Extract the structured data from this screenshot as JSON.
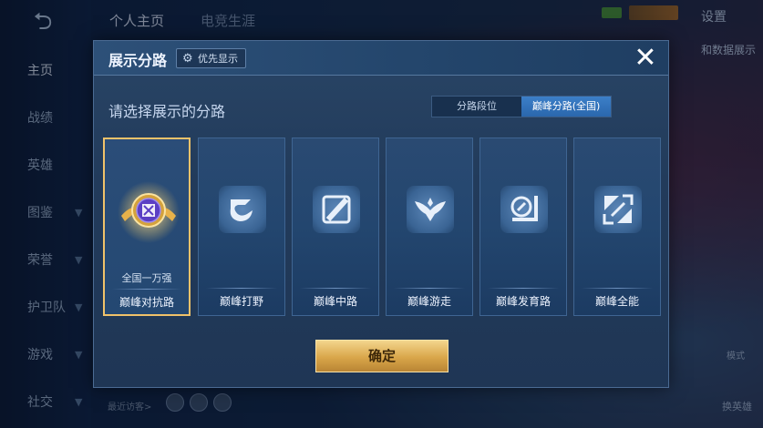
{
  "background": {
    "top_tabs": [
      "个人主页",
      "电竞生涯"
    ],
    "settings_label": "设置",
    "right_label": "和数据展示",
    "nav": [
      {
        "label": "主页"
      },
      {
        "label": "战绩"
      },
      {
        "label": "英雄"
      },
      {
        "label": "图鉴"
      },
      {
        "label": "荣誉"
      },
      {
        "label": "护卫队"
      },
      {
        "label": "游戏"
      },
      {
        "label": "社交"
      }
    ],
    "visitors_label": "最近访客>",
    "bottom_right_label": "换英雄",
    "bottom_right_label2": "模式"
  },
  "modal": {
    "title": "展示分路",
    "priority_label": "优先显示",
    "prompt": "请选择展示的分路",
    "toggle": {
      "left": "分路段位",
      "right": "巅峰分路(全国)",
      "active": "right"
    },
    "cards": [
      {
        "label": "巅峰对抗路",
        "sub": "全国一万强",
        "selected": true,
        "icon": "medal-icon"
      },
      {
        "label": "巅峰打野",
        "sub": "",
        "selected": false,
        "icon": "jungle-icon"
      },
      {
        "label": "巅峰中路",
        "sub": "",
        "selected": false,
        "icon": "mid-icon"
      },
      {
        "label": "巅峰游走",
        "sub": "",
        "selected": false,
        "icon": "roam-icon"
      },
      {
        "label": "巅峰发育路",
        "sub": "",
        "selected": false,
        "icon": "bot-icon"
      },
      {
        "label": "巅峰全能",
        "sub": "",
        "selected": false,
        "icon": "allround-icon"
      }
    ],
    "confirm_label": "确定",
    "colors": {
      "accent_gold": "#f0c26a",
      "toggle_active": "#3c7fc8"
    }
  }
}
